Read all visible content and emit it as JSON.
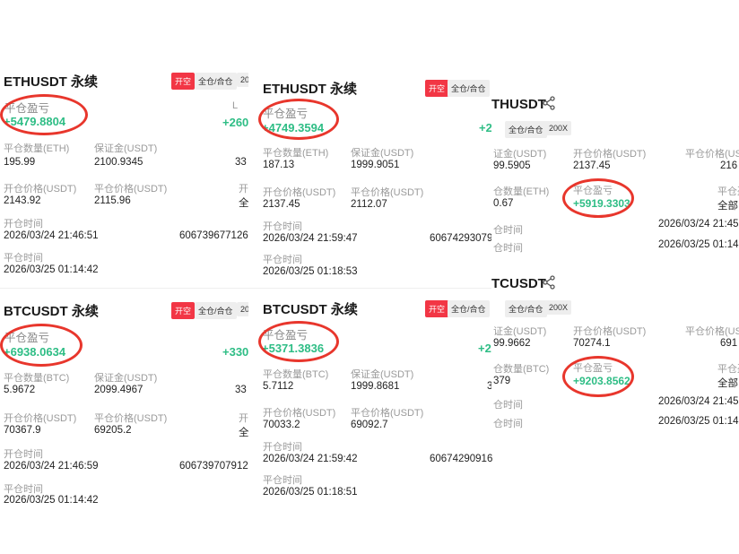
{
  "labels": {
    "pnl": "平仓盈亏",
    "close_qty_eth": "平仓数量(ETH)",
    "close_qty_btc": "平仓数量(BTC)",
    "margin": "保证金(USDT)",
    "open_price": "开仓价格(USDT)",
    "close_price": "平仓价格(USDT)",
    "open_time": "开仓时间",
    "close_time": "平仓时间",
    "margin_cut": "证金(USDT)",
    "qty_eth_cut": "仓数量(ETH)",
    "qty_btc_cut": "仓数量(BTC)",
    "open_time_cut": "仓时间",
    "close_time_cut": "仓时间",
    "open_price_cut": "开仓价格",
    "pnl_head_cut": "平仓盈",
    "lev_cut": "L",
    "full_cut": "全",
    "full_all_cut": "全部",
    "price_cut_btc": "691",
    "price_cut_eth": "216",
    "partial_33": "33",
    "partial_3": "3",
    "badge_open_short": "开空",
    "badge_cross": "全仓/合仓",
    "badge_cut": "20"
  },
  "cards": {
    "c1": {
      "title": "ETHUSDT 永续",
      "pnl": "+5479.8804",
      "qty": "195.99",
      "margin": "2100.9345",
      "open_price": "2143.92",
      "close_price": "2115.96",
      "open_time": "2026/03/24 21:46:51",
      "close_time": "2026/03/25 01:14:42",
      "order_id": "606739677126",
      "roi_cut": "+260"
    },
    "c2": {
      "title": "ETHUSDT 永续",
      "pnl": "+4749.3594",
      "qty": "187.13",
      "margin": "1999.9051",
      "open_price": "2137.45",
      "close_price": "2112.07",
      "open_time": "2026/03/24 21:59:47",
      "close_time": "2026/03/25 01:18:53",
      "order_id": "60674293079",
      "roi_cut": "+2"
    },
    "c3": {
      "title": "THUSDT",
      "leverage": "200X",
      "margin": "99.5905",
      "open_price": "2137.45",
      "qty": "0.67",
      "pnl": "+5919.3303",
      "open_time": "2026/03/24 21:45",
      "close_time": "2026/03/25 01:14"
    },
    "c4": {
      "title": "BTCUSDT 永续",
      "pnl": "+6938.0634",
      "qty": "5.9672",
      "margin": "2099.4967",
      "open_price": "70367.9",
      "close_price": "69205.2",
      "open_time": "2026/03/24 21:46:59",
      "close_time": "2026/03/25 01:14:42",
      "order_id": "606739707912",
      "roi_cut": "+330"
    },
    "c5": {
      "title": "BTCUSDT 永续",
      "pnl": "+5371.3836",
      "qty": "5.7112",
      "margin": "1999.8681",
      "open_price": "70033.2",
      "close_price": "69092.7",
      "open_time": "2026/03/24 21:59:42",
      "close_time": "2026/03/25 01:18:51",
      "order_id": "60674290916",
      "roi_cut": "+2"
    },
    "c6": {
      "title": "TCUSDT",
      "leverage": "200X",
      "margin": "99.9662",
      "open_price": "70274.1",
      "qty": "379",
      "pnl": "+9203.8562",
      "open_time": "2026/03/24 21:45",
      "close_time": "2026/03/25 01:14"
    }
  },
  "colors": {
    "profit": "#2ebd85",
    "badge_red": "#f23645",
    "ring": "#e8362c"
  }
}
